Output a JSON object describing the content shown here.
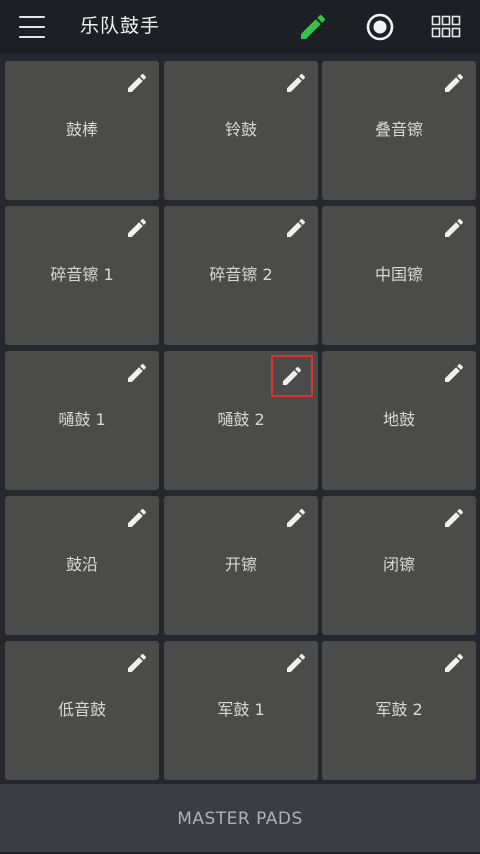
{
  "header": {
    "title": "乐队鼓手",
    "edit_icon_color": "#36c24a"
  },
  "pads": [
    {
      "label": "鼓棒"
    },
    {
      "label": "铃鼓"
    },
    {
      "label": "叠音镲"
    },
    {
      "label": "碎音镲 1"
    },
    {
      "label": "碎音镲 2"
    },
    {
      "label": "中国镲"
    },
    {
      "label": "嗵鼓 1"
    },
    {
      "label": "嗵鼓 2",
      "highlighted": true
    },
    {
      "label": "地鼓"
    },
    {
      "label": "鼓沿"
    },
    {
      "label": "开镲"
    },
    {
      "label": "闭镲"
    },
    {
      "label": "低音鼓"
    },
    {
      "label": "军鼓 1"
    },
    {
      "label": "军鼓 2"
    }
  ],
  "footer": {
    "label": "MASTER PADS"
  },
  "colors": {
    "pad": "#4b4c49",
    "highlight": "#e0322f"
  }
}
